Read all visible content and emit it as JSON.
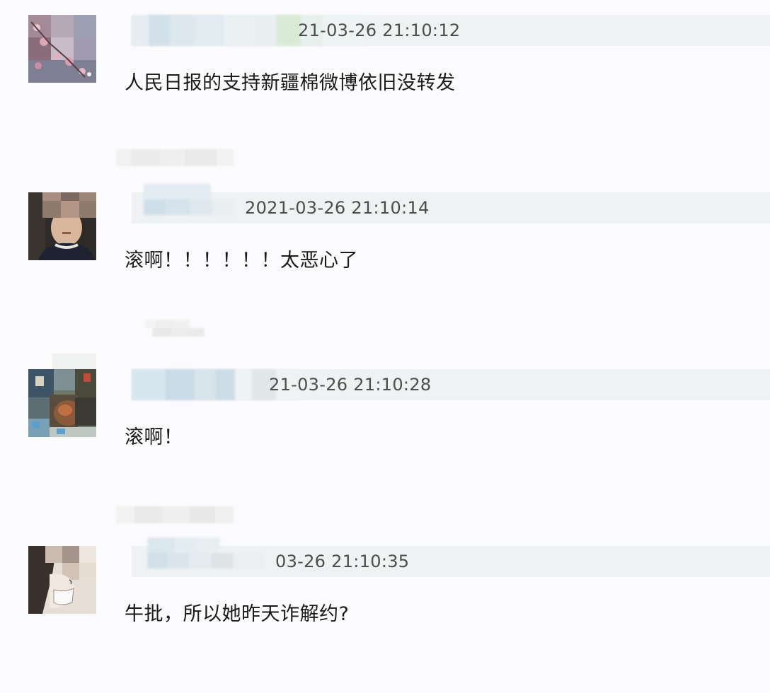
{
  "comments": [
    {
      "timestamp": "21-03-26 21:10:12",
      "content": "人民日报的支持新疆棉微博依旧没转发",
      "avatar_icon": "blossom-avatar-icon"
    },
    {
      "timestamp": "2021-03-26 21:10:14",
      "content": "滚啊！！！！！！太恶心了",
      "avatar_icon": "boy-avatar-icon"
    },
    {
      "timestamp": "21-03-26 21:10:28",
      "content": "滚啊！",
      "avatar_icon": "anime-avatar-icon"
    },
    {
      "timestamp": "03-26 21:10:35",
      "content": "牛批，所以她昨天诈解约?",
      "avatar_icon": "masked-person-avatar-icon"
    }
  ],
  "colors": {
    "background": "#fbfbfd",
    "meta_bar": "#eef2f2",
    "text": "#1a1a1a",
    "timestamp": "#4d4d4d"
  }
}
